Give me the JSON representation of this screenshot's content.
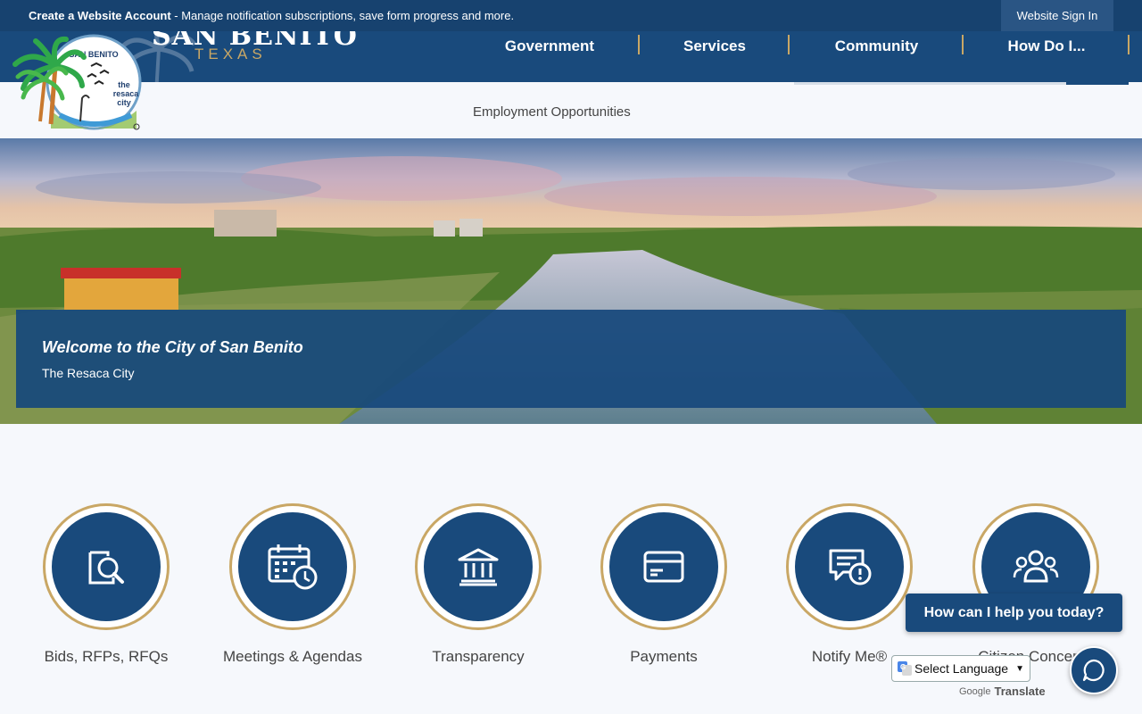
{
  "topbar": {
    "account_bold": "Create a Website Account",
    "account_rest": " - Manage notification subscriptions, save form progress and more.",
    "signin_label": "Website Sign In"
  },
  "brand": {
    "title": "SAN BENITO",
    "subtitle": "TEXAS",
    "logo_text_top": "SAN BENITO",
    "logo_text_1": "the",
    "logo_text_2": "resaca",
    "logo_text_3": "city"
  },
  "nav": {
    "items": [
      {
        "label": "Government"
      },
      {
        "label": "Services"
      },
      {
        "label": "Community"
      },
      {
        "label": "How Do I..."
      }
    ]
  },
  "subnav": {
    "employment_label": "Employment Opportunities"
  },
  "hero": {
    "welcome_title": "Welcome to the City of San Benito",
    "welcome_subtitle": "The Resaca City"
  },
  "quick_links": [
    {
      "label": "Bids, RFPs, RFQs",
      "icon": "document-search-icon"
    },
    {
      "label": "Meetings & Agendas",
      "icon": "calendar-clock-icon"
    },
    {
      "label": "Transparency",
      "icon": "government-building-icon"
    },
    {
      "label": "Payments",
      "icon": "credit-card-icon"
    },
    {
      "label": "Notify Me®",
      "icon": "message-alert-icon"
    },
    {
      "label": "Citizen Concerns",
      "icon": "people-group-icon"
    }
  ],
  "chat": {
    "prompt": "How can I help you today?"
  },
  "translate": {
    "select_label": "Select Language",
    "powered_google": "Google",
    "powered_translate": "Translate"
  },
  "colors": {
    "navy": "#194a7c",
    "gold": "#c9a765",
    "topbar": "#17426f"
  }
}
